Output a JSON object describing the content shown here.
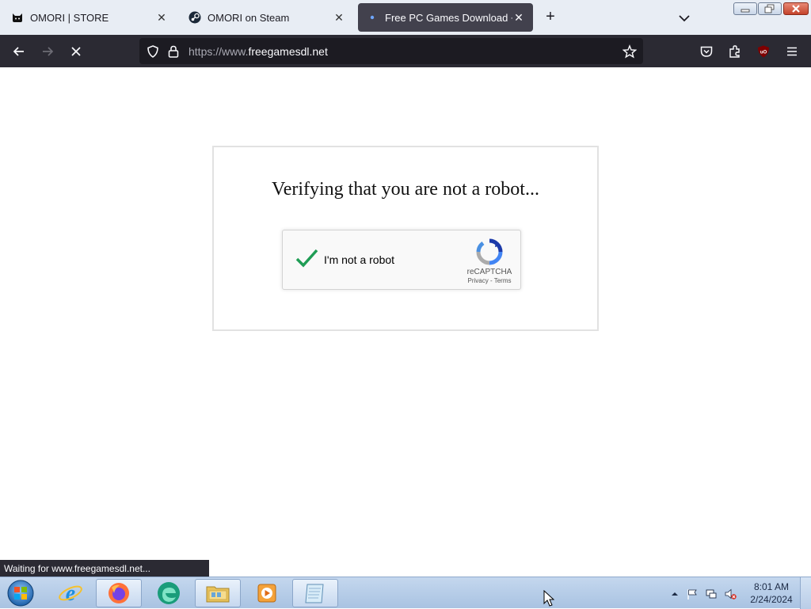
{
  "browser": {
    "tabs": [
      {
        "title": "OMORI | STORE",
        "active": false,
        "favicon": "cat-icon"
      },
      {
        "title": "OMORI on Steam",
        "active": false,
        "favicon": "steam-icon"
      },
      {
        "title": "Free PC Games Download + Dir",
        "active": true,
        "favicon": "loading-dot-icon"
      }
    ],
    "close_glyph": "✕",
    "new_tab_glyph": "+",
    "url": {
      "scheme": "https://www.",
      "host": "freegamesdl.net"
    },
    "status_text": "Waiting for www.freegamesdl.net..."
  },
  "page": {
    "heading": "Verifying that you are not a robot...",
    "recaptcha": {
      "label": "I'm not a robot",
      "brand": "reCAPTCHA",
      "links": "Privacy - Terms",
      "checked": true
    }
  },
  "taskbar": {
    "apps": [
      "internet-explorer-icon",
      "firefox-icon",
      "edge-icon",
      "file-explorer-icon",
      "media-player-icon",
      "notepad-icon"
    ],
    "clock": {
      "time": "8:01 AM",
      "date": "2/24/2024"
    }
  },
  "colors": {
    "tab_strip": "#e8edf4",
    "nav_bar": "#2b2a33",
    "url_field": "#1c1b22",
    "active_tab": "#42414d",
    "check_green": "#1f9d55",
    "recaptcha_blue": "#4a90e2"
  }
}
